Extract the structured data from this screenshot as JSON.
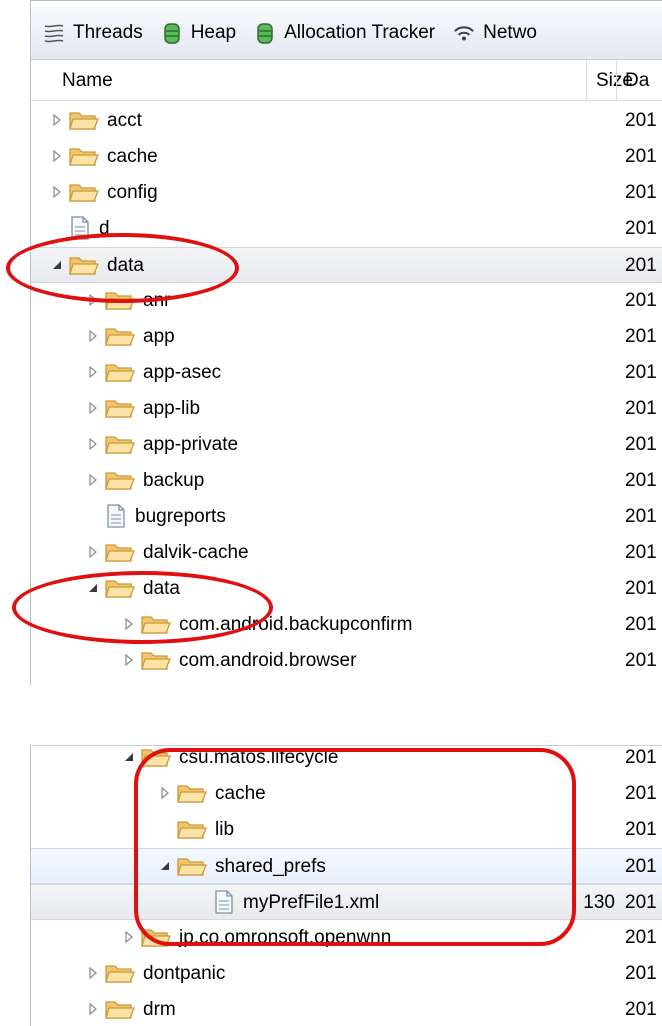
{
  "toolbar": {
    "tabs": [
      {
        "label": "Threads",
        "icon": "threads-icon"
      },
      {
        "label": "Heap",
        "icon": "heap-icon"
      },
      {
        "label": "Allocation Tracker",
        "icon": "allocation-tracker-icon"
      },
      {
        "label": "Netwo",
        "icon": "network-icon"
      }
    ]
  },
  "columns": {
    "name": "Name",
    "size": "Size",
    "date": "Da"
  },
  "top_rows": [
    {
      "label": "acct",
      "type": "folder",
      "state": "collapsed",
      "level": 0,
      "size": "",
      "date": "201"
    },
    {
      "label": "cache",
      "type": "folder",
      "state": "collapsed",
      "level": 0,
      "size": "",
      "date": "201"
    },
    {
      "label": "config",
      "type": "folder",
      "state": "collapsed",
      "level": 0,
      "size": "",
      "date": "201"
    },
    {
      "label": "d",
      "type": "file",
      "state": "none",
      "level": 0,
      "size": "",
      "date": "201"
    },
    {
      "label": "data",
      "type": "folder",
      "state": "expanded",
      "level": 0,
      "size": "",
      "date": "201",
      "selected": true
    },
    {
      "label": "anr",
      "type": "folder",
      "state": "collapsed",
      "level": 1,
      "size": "",
      "date": "201"
    },
    {
      "label": "app",
      "type": "folder",
      "state": "collapsed",
      "level": 1,
      "size": "",
      "date": "201"
    },
    {
      "label": "app-asec",
      "type": "folder",
      "state": "collapsed",
      "level": 1,
      "size": "",
      "date": "201"
    },
    {
      "label": "app-lib",
      "type": "folder",
      "state": "collapsed",
      "level": 1,
      "size": "",
      "date": "201"
    },
    {
      "label": "app-private",
      "type": "folder",
      "state": "collapsed",
      "level": 1,
      "size": "",
      "date": "201"
    },
    {
      "label": "backup",
      "type": "folder",
      "state": "collapsed",
      "level": 1,
      "size": "",
      "date": "201"
    },
    {
      "label": "bugreports",
      "type": "file",
      "state": "none",
      "level": 1,
      "size": "",
      "date": "201"
    },
    {
      "label": "dalvik-cache",
      "type": "folder",
      "state": "collapsed",
      "level": 1,
      "size": "",
      "date": "201"
    },
    {
      "label": "data",
      "type": "folder",
      "state": "expanded",
      "level": 1,
      "size": "",
      "date": "201"
    },
    {
      "label": "com.android.backupconfirm",
      "type": "folder",
      "state": "collapsed",
      "level": 2,
      "size": "",
      "date": "201"
    },
    {
      "label": "com.android.browser",
      "type": "folder",
      "state": "collapsed",
      "level": 2,
      "size": "",
      "date": "201"
    }
  ],
  "bottom_rows": [
    {
      "label": "csu.matos.lifecycle",
      "type": "folder",
      "state": "expanded",
      "level": 2,
      "size": "",
      "date": "201"
    },
    {
      "label": "cache",
      "type": "folder",
      "state": "collapsed",
      "level": 3,
      "size": "",
      "date": "201"
    },
    {
      "label": "lib",
      "type": "folder",
      "state": "none",
      "level": 3,
      "size": "",
      "date": "201"
    },
    {
      "label": "shared_prefs",
      "type": "folder",
      "state": "expanded",
      "level": 3,
      "size": "",
      "date": "201",
      "hover": true
    },
    {
      "label": "myPrefFile1.xml",
      "type": "file",
      "state": "none",
      "level": 4,
      "size": "130",
      "date": "201",
      "selected": true
    },
    {
      "label": "jp.co.omronsoft.openwnn",
      "type": "folder",
      "state": "collapsed",
      "level": 2,
      "size": "",
      "date": "201"
    },
    {
      "label": "dontpanic",
      "type": "folder",
      "state": "collapsed",
      "level": 1,
      "size": "",
      "date": "201"
    },
    {
      "label": "drm",
      "type": "folder",
      "state": "collapsed",
      "level": 1,
      "size": "",
      "date": "201"
    }
  ],
  "colors": {
    "highlight_ring": "#e01010",
    "folder": "#f2c46b",
    "folder_edge": "#c99a3a"
  }
}
